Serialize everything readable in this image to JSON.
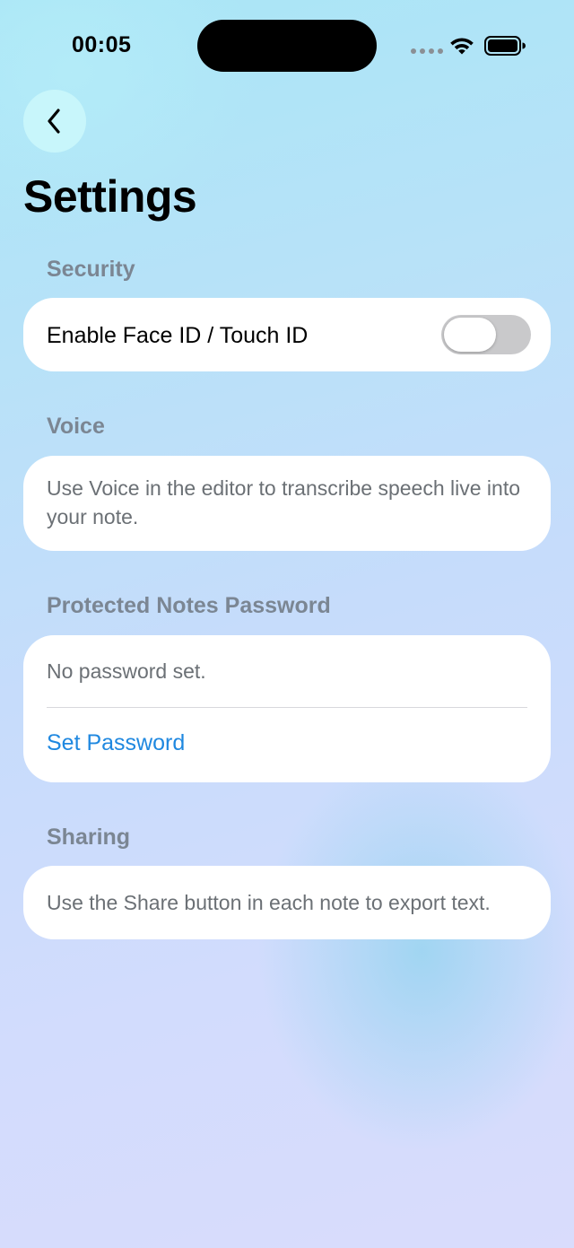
{
  "status_bar": {
    "time": "00:05"
  },
  "header": {
    "back_icon": "chevron-left-icon",
    "title": "Settings"
  },
  "sections": {
    "security": {
      "header": "Security",
      "face_id_label": "Enable Face ID / Touch ID",
      "face_id_enabled": false
    },
    "voice": {
      "header": "Voice",
      "description": "Use Voice in the editor to transcribe speech live into your note."
    },
    "password": {
      "header": "Protected Notes Password",
      "status": "No password set.",
      "action_label": "Set Password"
    },
    "sharing": {
      "header": "Sharing",
      "description": "Use the Share button in each note to export text."
    }
  },
  "colors": {
    "accent": "#1f88e0",
    "section_header": "#7b8693",
    "toggle_off": "#c9c9cb"
  }
}
